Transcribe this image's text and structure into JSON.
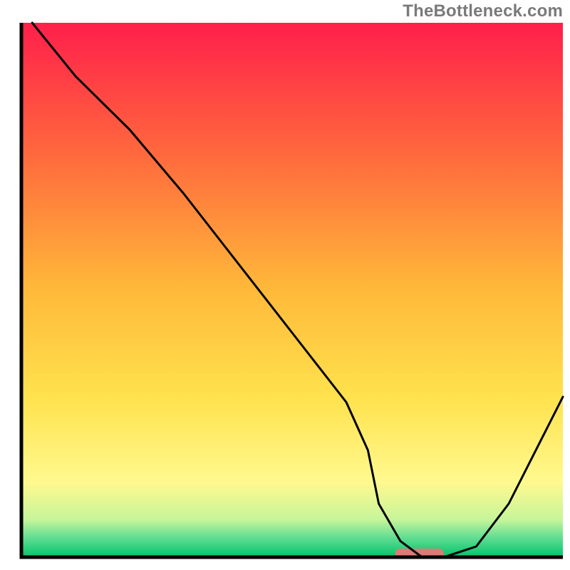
{
  "watermark": "TheBottleneck.com",
  "chart_data": {
    "type": "line",
    "title": "",
    "xlabel": "",
    "ylabel": "",
    "xlim": [
      0,
      100
    ],
    "ylim": [
      0,
      100
    ],
    "x": [
      2,
      10,
      20,
      30,
      40,
      50,
      60,
      64,
      66,
      70,
      74,
      78,
      84,
      90,
      100
    ],
    "values": [
      100,
      90,
      80,
      68,
      55,
      42,
      29,
      20,
      10,
      3,
      0,
      0,
      2,
      10,
      30
    ],
    "marker": {
      "x_start": 69,
      "x_end": 78,
      "y": 0
    },
    "colors": {
      "gradient_stops": [
        {
          "offset": 0.0,
          "color": "#ff1f4b"
        },
        {
          "offset": 0.25,
          "color": "#ff6a3d"
        },
        {
          "offset": 0.5,
          "color": "#ffb93a"
        },
        {
          "offset": 0.7,
          "color": "#ffe24d"
        },
        {
          "offset": 0.86,
          "color": "#fff98f"
        },
        {
          "offset": 0.93,
          "color": "#c6f59a"
        },
        {
          "offset": 0.965,
          "color": "#5ddc91"
        },
        {
          "offset": 1.0,
          "color": "#00c46a"
        }
      ],
      "line": "#000000",
      "marker_fill": "#e07a77",
      "axis": "#000000"
    }
  }
}
